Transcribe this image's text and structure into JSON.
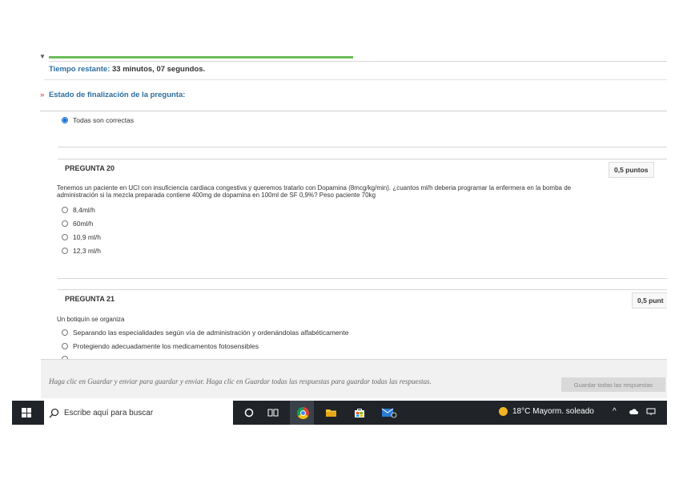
{
  "quiz": {
    "time_label": "Tiempo restante:",
    "time_value": "33 minutos, 07 segundos.",
    "status_marker": "»",
    "status_label": "Estado de finalización de la pregunta:",
    "prev_selected_option": "Todas son correctas",
    "progress_fraction": 0.5
  },
  "questions": [
    {
      "header": "PREGUNTA 20",
      "points": "0,5 puntos",
      "text": "Tenemos un paciente en UCI con insuficiencia cardiaca congestiva y queremos tratarlo con Dopamina (8mcg/kg/min). ¿cuantos ml/h deberia programar la enfermera en la bomba de administración si la mezcla preparada contiene 400mg de dopamina en 100ml de SF 0,9%? Peso paciente 70kg",
      "options": [
        "8,4ml/h",
        "60ml/h",
        "10,9 ml/h",
        "12,3 ml/h"
      ]
    },
    {
      "header": "PREGUNTA 21",
      "points": "0,5 punt",
      "text": "Un botiquín se organiza",
      "options": [
        "Separando las especialidades según vía de administración y ordenándolas alfabéticamente",
        "Protegiendo adecuadamente los medicamentos fotosensibles"
      ]
    }
  ],
  "footer": {
    "instructions": "Haga clic en Guardar y enviar para guardar y enviar. Haga clic en Guardar todas las respuestas para guardar todas las respuestas.",
    "save_all_label": "Guardar todas las respuestas"
  },
  "taskbar": {
    "search_placeholder": "Escribe aquí para buscar",
    "weather": "18°C  Mayorm. soleado",
    "tray_up": "^"
  },
  "icons": {
    "windows": "windows-icon",
    "search": "search-icon",
    "cortana": "cortana-icon",
    "task_view": "task-view-icon",
    "chrome": "chrome-icon",
    "file_explorer": "file-explorer-icon",
    "store": "store-icon",
    "mail": "mail-icon",
    "weather": "sun-icon",
    "cloud": "cloud-icon",
    "network": "network-icon"
  }
}
